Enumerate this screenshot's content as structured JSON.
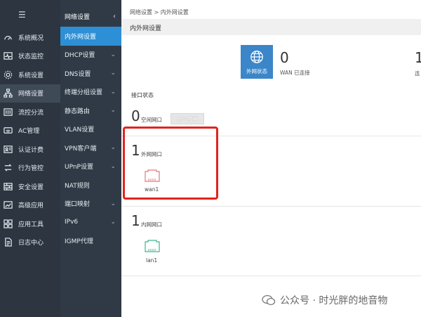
{
  "left_menu_toggle": "☰",
  "left_nav": [
    {
      "label": "系统概况",
      "icon": "speedometer-icon"
    },
    {
      "label": "状态监控",
      "icon": "pulse-icon"
    },
    {
      "label": "系统设置",
      "icon": "gear-icon"
    },
    {
      "label": "网络设置",
      "icon": "network-icon"
    },
    {
      "label": "流控分流",
      "icon": "sliders-icon"
    },
    {
      "label": "AC管理",
      "icon": "wifi-icon"
    },
    {
      "label": "认证计费",
      "icon": "id-card-icon"
    },
    {
      "label": "行为管控",
      "icon": "arrows-icon"
    },
    {
      "label": "安全设置",
      "icon": "firewall-icon"
    },
    {
      "label": "高级应用",
      "icon": "chart-icon"
    },
    {
      "label": "应用工具",
      "icon": "apps-icon"
    },
    {
      "label": "日志中心",
      "icon": "document-icon"
    }
  ],
  "sub_nav_header": "网络设置",
  "sub_nav": [
    {
      "label": "内外网设置",
      "arrow": ""
    },
    {
      "label": "DHCP设置",
      "arrow": "v"
    },
    {
      "label": "DNS设置",
      "arrow": "v"
    },
    {
      "label": "终端分组设置",
      "arrow": "v"
    },
    {
      "label": "静态路由",
      "arrow": "v"
    },
    {
      "label": "VLAN设置",
      "arrow": ""
    },
    {
      "label": "VPN客户端",
      "arrow": "v"
    },
    {
      "label": "UPnP设置",
      "arrow": "v"
    },
    {
      "label": "NAT规则",
      "arrow": ""
    },
    {
      "label": "端口映射",
      "arrow": "v"
    },
    {
      "label": "IPv6",
      "arrow": "v"
    },
    {
      "label": "IGMP代理",
      "arrow": ""
    }
  ],
  "breadcrumb": "网络设置 > 内外网设置",
  "page_title": "内外网设置",
  "stats": {
    "tile_label": "外网状态",
    "wan_connected_count": "0",
    "wan_connected_label": "WAN 已连接",
    "second_count": "1",
    "second_label": "连"
  },
  "interface_status": {
    "title": "接口状态",
    "idle_count": "0",
    "idle_label": "空闲网口",
    "new_config_button": "新增配置",
    "wan_count": "1",
    "wan_label": "外网网口",
    "wan_port_name": "wan1",
    "wan_port_color": "#e07a7a",
    "lan_count": "1",
    "lan_label": "内网网口",
    "lan_port_name": "lan1",
    "lan_port_color": "#3fb58a"
  },
  "watermark": "公众号 · 时光胖的地音物"
}
